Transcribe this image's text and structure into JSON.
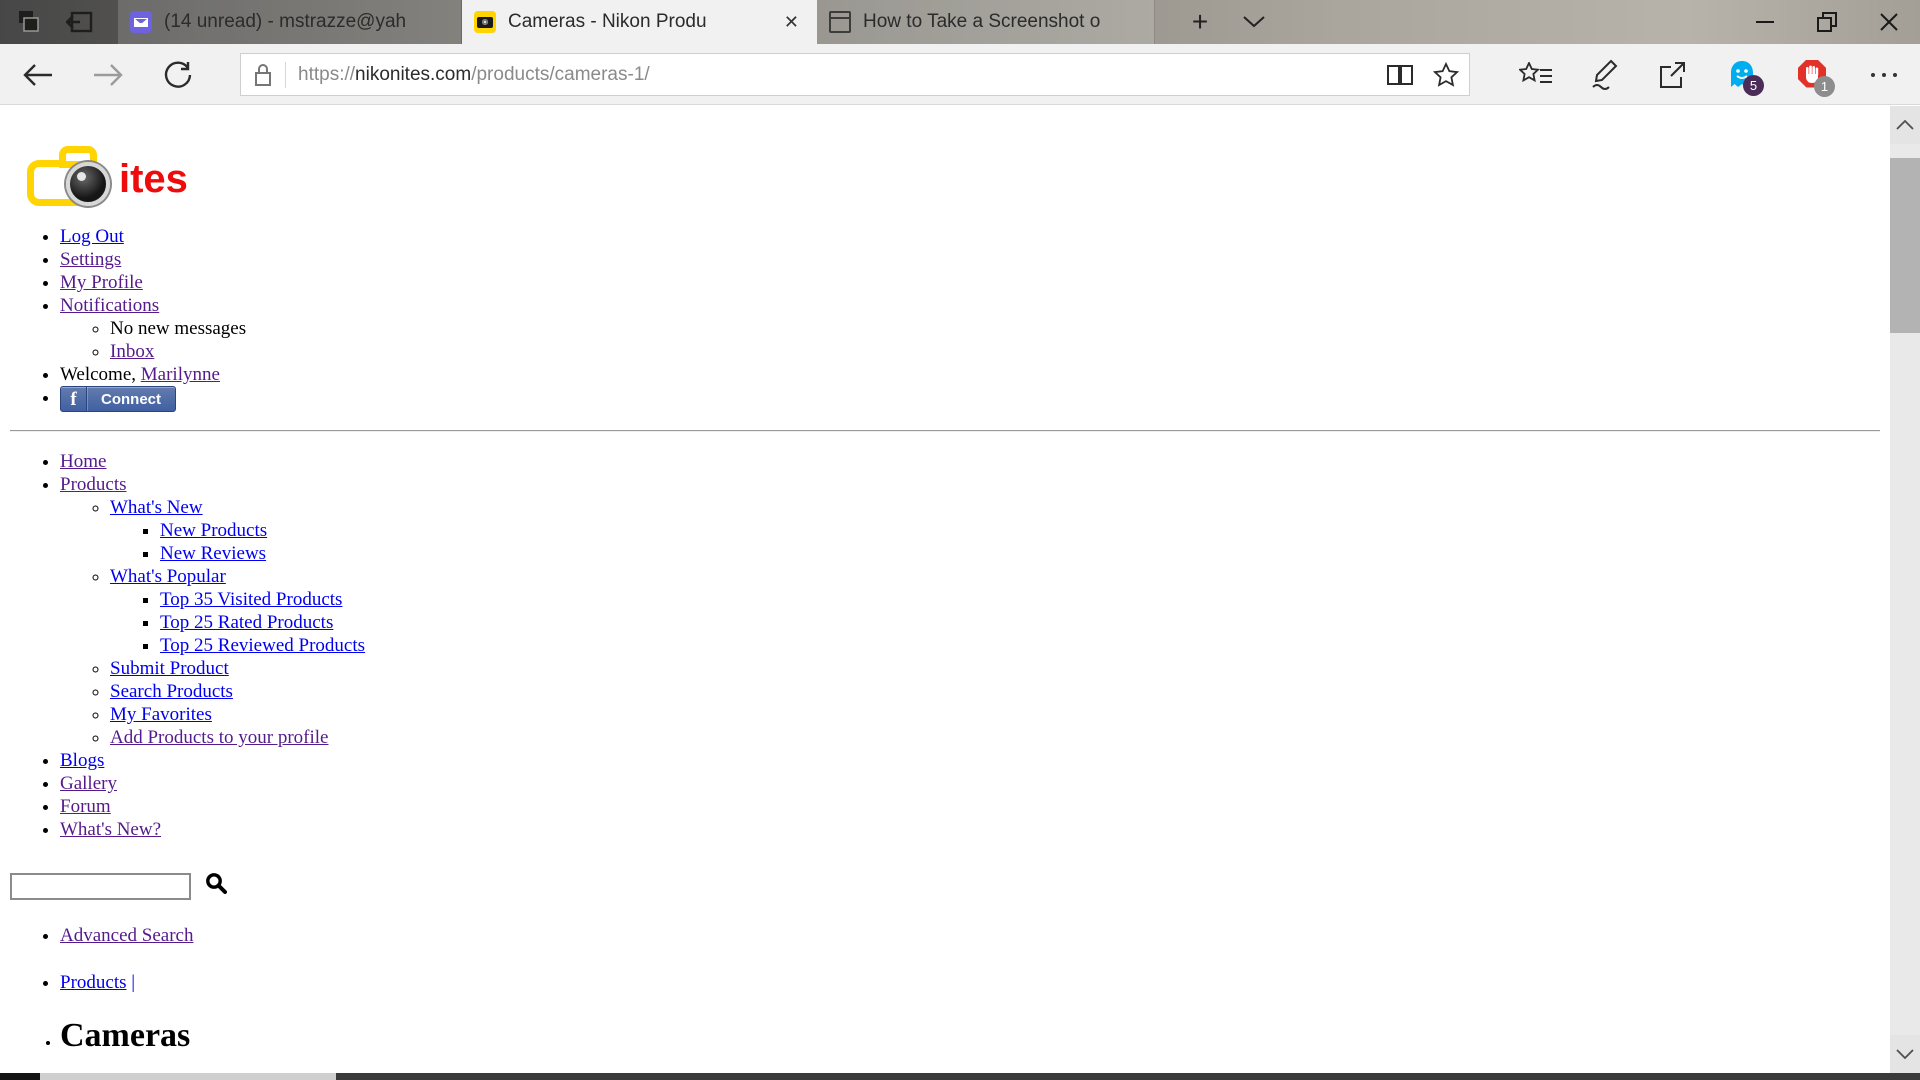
{
  "browser": {
    "tabs": [
      {
        "title": "(14 unread) - mstrazze@yah",
        "favicon": "yahoo-mail-icon"
      },
      {
        "title": "Cameras - Nikon Produ",
        "favicon": "camera-icon",
        "close_glyph": "✕"
      },
      {
        "title": "How to Take a Screenshot o",
        "favicon": "page-icon"
      }
    ],
    "new_tab_glyph": "+",
    "window": {
      "minimize_glyph": "—",
      "close_glyph": "✕"
    }
  },
  "address_bar": {
    "scheme": "https://",
    "domain": "nikonites.com",
    "path": "/products/cameras-1/",
    "extensions": [
      {
        "name": "ghostery",
        "badge": "5"
      },
      {
        "name": "content-blocker",
        "badge": "1"
      }
    ]
  },
  "page": {
    "logo_suffix": "ites",
    "user_menu": {
      "log_out": "Log Out",
      "settings": "Settings",
      "my_profile": "My Profile",
      "notifications": "Notifications",
      "no_new_messages": "No new messages",
      "inbox": "Inbox",
      "welcome_prefix": "Welcome, ",
      "username": "Marilynne",
      "fb_f": "f",
      "fb_connect": "Connect"
    },
    "main_menu": {
      "home": "Home",
      "products": "Products",
      "whats_new": "What's New",
      "new_products": "New Products",
      "new_reviews": "New Reviews",
      "whats_popular": "What's Popular",
      "top_visited": "Top 35 Visited Products",
      "top_rated": "Top 25 Rated Products",
      "top_reviewed": "Top 25 Reviewed Products",
      "submit_product": "Submit Product",
      "search_products": "Search Products",
      "my_favorites": "My Favorites",
      "add_products": "Add Products to your profile",
      "blogs": "Blogs",
      "gallery": "Gallery",
      "forum": "Forum",
      "whats_new_q": "What's New?"
    },
    "search": {
      "value": ""
    },
    "advanced_search": "Advanced Search",
    "breadcrumb": {
      "products": "Products",
      "separator": "|"
    },
    "heading": "Cameras"
  },
  "colors": {
    "link_new": "#0000EE",
    "link_visited": "#551A8B",
    "logo_yellow": "#ffd400",
    "logo_red": "#ee0b0b",
    "facebook_blue": "#4160a2",
    "ghostery_blue": "#00aef0",
    "blocker_red": "#e23128"
  }
}
